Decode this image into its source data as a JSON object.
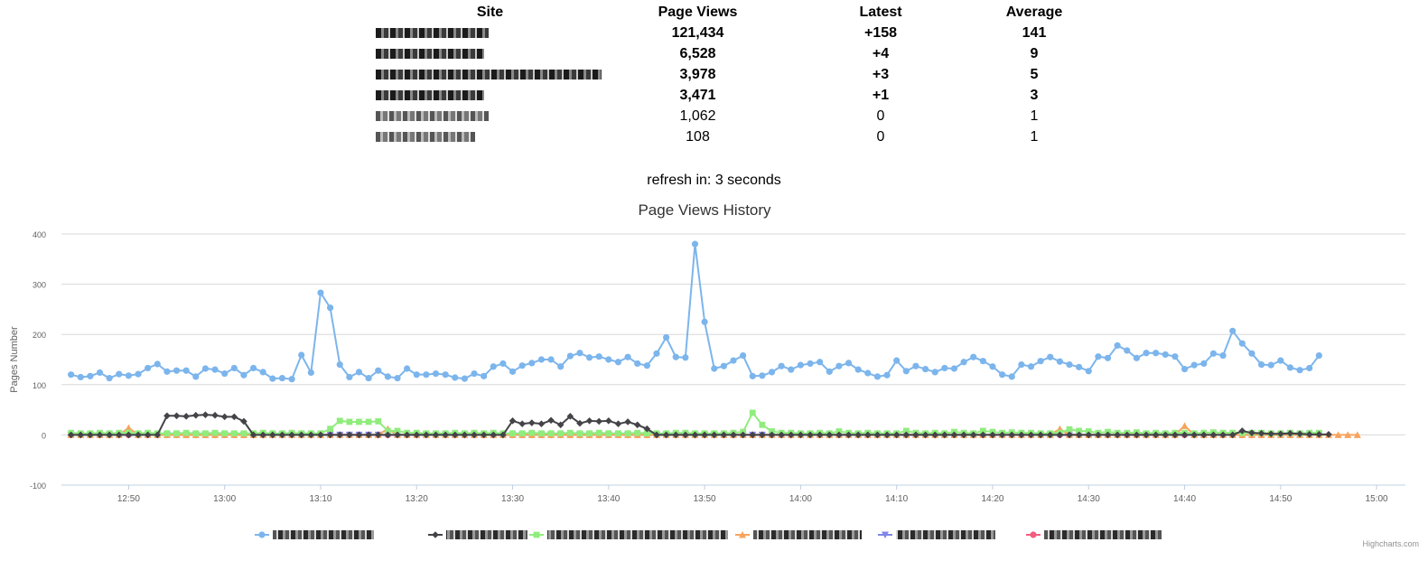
{
  "table": {
    "headers": {
      "site": "Site",
      "views": "Page Views",
      "latest": "Latest",
      "average": "Average"
    },
    "rows": [
      {
        "views": "121,434",
        "latest": "+158",
        "average": "141",
        "bold": true
      },
      {
        "views": "6,528",
        "latest": "+4",
        "average": "9",
        "bold": true
      },
      {
        "views": "3,978",
        "latest": "+3",
        "average": "5",
        "bold": true
      },
      {
        "views": "3,471",
        "latest": "+1",
        "average": "3",
        "bold": true
      },
      {
        "views": "1,062",
        "latest": "0",
        "average": "1",
        "bold": false
      },
      {
        "views": "108",
        "latest": "0",
        "average": "1",
        "bold": false
      }
    ]
  },
  "refresh": {
    "text": "refresh in: 3 seconds"
  },
  "credits": "Highcharts.com",
  "chart_data": {
    "type": "line",
    "title": "Page Views History",
    "ylabel": "Pages Number",
    "ylim": [
      -100,
      400
    ],
    "yticks": [
      -100,
      0,
      100,
      200,
      300,
      400
    ],
    "xlim": [
      "12:43",
      "15:03"
    ],
    "xticks": [
      "12:50",
      "13:00",
      "13:10",
      "13:20",
      "13:30",
      "13:40",
      "13:50",
      "14:00",
      "14:10",
      "14:20",
      "14:30",
      "14:40",
      "14:50",
      "15:00"
    ],
    "x_start": "12:44",
    "x_step_minutes": 1,
    "grid": true,
    "legend_position": "bottom",
    "series": [
      {
        "color": "#7cb5ec",
        "marker": "circle",
        "values": [
          120,
          115,
          117,
          124,
          113,
          121,
          118,
          121,
          133,
          141,
          126,
          128,
          128,
          116,
          132,
          130,
          122,
          133,
          119,
          133,
          125,
          112,
          113,
          111,
          159,
          124,
          283,
          253,
          140,
          115,
          125,
          113,
          128,
          116,
          113,
          132,
          120,
          120,
          122,
          120,
          114,
          112,
          122,
          117,
          136,
          142,
          126,
          138,
          143,
          150,
          150,
          136,
          157,
          163,
          154,
          156,
          150,
          145,
          155,
          142,
          138,
          162,
          194,
          155,
          154,
          380,
          225,
          132,
          137,
          148,
          158,
          117,
          118,
          125,
          137,
          130,
          139,
          142,
          145,
          126,
          137,
          143,
          130,
          123,
          116,
          119,
          148,
          127,
          137,
          131,
          125,
          133,
          132,
          145,
          155,
          147,
          136,
          120,
          116,
          140,
          136,
          147,
          155,
          146,
          140,
          135,
          127,
          156,
          153,
          178,
          168,
          153,
          163,
          163,
          160,
          156,
          131,
          139,
          142,
          162,
          158,
          207,
          182,
          162,
          140,
          139,
          148,
          134,
          129,
          133,
          158
        ]
      },
      {
        "color": "#434348",
        "marker": "diamond",
        "values": [
          0,
          0,
          0,
          0,
          0,
          0,
          0,
          0,
          0,
          0,
          38,
          38,
          37,
          39,
          40,
          39,
          36,
          36,
          27,
          0,
          0,
          0,
          0,
          0,
          0,
          0,
          0,
          0,
          0,
          0,
          0,
          0,
          0,
          0,
          0,
          0,
          0,
          0,
          0,
          0,
          0,
          0,
          0,
          0,
          0,
          0,
          28,
          22,
          24,
          22,
          29,
          20,
          37,
          23,
          28,
          27,
          28,
          22,
          26,
          20,
          12,
          0,
          0,
          0,
          0,
          0,
          0,
          0,
          0,
          0,
          0,
          0,
          0,
          0,
          0,
          0,
          0,
          0,
          0,
          0,
          0,
          0,
          0,
          0,
          0,
          0,
          0,
          0,
          0,
          0,
          0,
          0,
          0,
          0,
          0,
          0,
          0,
          0,
          0,
          0,
          0,
          0,
          0,
          0,
          0,
          0,
          0,
          0,
          0,
          0,
          0,
          0,
          0,
          0,
          0,
          0,
          0,
          0,
          0,
          0,
          0,
          0,
          8,
          4,
          3,
          2,
          2,
          3,
          2,
          1,
          1,
          1
        ]
      },
      {
        "color": "#90ed7d",
        "marker": "square",
        "values": [
          4,
          3,
          3,
          4,
          3,
          4,
          4,
          3,
          4,
          3,
          3,
          3,
          4,
          3,
          3,
          4,
          3,
          3,
          3,
          3,
          4,
          3,
          3,
          4,
          3,
          3,
          3,
          12,
          28,
          26,
          26,
          26,
          27,
          8,
          8,
          4,
          4,
          3,
          3,
          3,
          4,
          3,
          4,
          3,
          4,
          3,
          3,
          3,
          4,
          3,
          3,
          3,
          4,
          3,
          3,
          4,
          3,
          3,
          3,
          4,
          3,
          3,
          3,
          4,
          4,
          3,
          3,
          3,
          3,
          4,
          6,
          44,
          20,
          7,
          4,
          4,
          3,
          3,
          4,
          3,
          7,
          4,
          3,
          4,
          3,
          3,
          3,
          8,
          4,
          3,
          4,
          3,
          6,
          4,
          3,
          8,
          6,
          4,
          5,
          4,
          4,
          3,
          3,
          4,
          11,
          8,
          7,
          4,
          6,
          4,
          4,
          5,
          3,
          4,
          3,
          4,
          4,
          3,
          4,
          5,
          4,
          4,
          4,
          4,
          4,
          3,
          3,
          4,
          3,
          4,
          4
        ]
      },
      {
        "color": "#f7a35c",
        "marker": "triangle",
        "values": [
          0,
          0,
          0,
          0,
          0,
          0,
          14,
          0,
          0,
          0,
          0,
          0,
          0,
          0,
          0,
          0,
          0,
          0,
          0,
          0,
          0,
          0,
          0,
          0,
          0,
          0,
          0,
          0,
          0,
          0,
          0,
          0,
          0,
          12,
          0,
          0,
          0,
          0,
          0,
          0,
          0,
          0,
          0,
          0,
          0,
          0,
          0,
          0,
          0,
          0,
          0,
          0,
          0,
          0,
          0,
          0,
          0,
          0,
          0,
          0,
          0,
          0,
          0,
          0,
          0,
          0,
          0,
          0,
          0,
          0,
          0,
          0,
          0,
          0,
          0,
          0,
          0,
          0,
          0,
          0,
          0,
          0,
          0,
          0,
          0,
          0,
          0,
          0,
          0,
          0,
          0,
          0,
          0,
          0,
          0,
          0,
          0,
          0,
          0,
          0,
          0,
          0,
          0,
          12,
          0,
          0,
          0,
          0,
          0,
          0,
          0,
          0,
          0,
          0,
          0,
          0,
          18,
          0,
          0,
          0,
          0,
          0,
          0,
          0,
          0,
          0,
          0,
          0,
          0,
          0,
          0,
          0,
          0,
          0,
          0
        ]
      },
      {
        "color": "#8085e9",
        "marker": "triangle-down",
        "values": [
          0,
          0,
          0,
          0,
          0,
          0,
          0,
          0,
          0,
          0,
          0,
          0,
          0,
          0,
          0,
          0,
          0,
          0,
          0,
          0,
          0,
          0,
          0,
          0,
          0,
          0,
          0,
          0,
          0,
          0,
          0,
          0,
          0,
          0,
          0,
          0,
          0,
          0,
          0,
          0,
          0,
          0,
          0,
          0,
          0,
          0,
          0,
          0,
          0,
          0,
          0,
          0,
          0,
          0,
          0,
          0,
          0,
          0,
          0,
          0,
          0,
          0,
          0,
          0,
          0,
          0,
          0,
          0,
          0,
          0,
          0,
          0,
          0,
          0,
          0,
          0,
          0,
          0,
          0,
          0,
          0,
          0,
          0,
          0,
          0,
          0,
          0,
          0,
          0,
          0,
          0,
          0,
          0,
          0,
          0,
          0,
          0,
          0,
          0,
          0,
          0,
          0,
          0,
          0,
          0,
          0,
          0,
          0,
          0,
          0,
          0,
          0,
          0,
          0,
          0,
          0,
          0,
          0,
          0,
          0,
          0,
          0,
          0,
          0,
          0,
          0,
          0,
          0,
          0,
          0,
          0
        ]
      },
      {
        "color": "#f15c80",
        "marker": "circle",
        "values": [
          0,
          0,
          0,
          0,
          0,
          0,
          0,
          0,
          0,
          0,
          0,
          0,
          0,
          0,
          0,
          0,
          0,
          0,
          0,
          0,
          0,
          0,
          0,
          0,
          0,
          0,
          0,
          0,
          0,
          0,
          0,
          0,
          0,
          0,
          0,
          0,
          0,
          0,
          0,
          0,
          0,
          0,
          0,
          0,
          0,
          0,
          0,
          0,
          0,
          0,
          0,
          0,
          0,
          0,
          0,
          0,
          0,
          0,
          0,
          0,
          0,
          0,
          0,
          0,
          0,
          0,
          0,
          0,
          0,
          0,
          0,
          0,
          0,
          0,
          0,
          0,
          0,
          0,
          0,
          0,
          0,
          0,
          0,
          0,
          0,
          0,
          0,
          0,
          0,
          0,
          0,
          0,
          0,
          0,
          0,
          0,
          0,
          0,
          0,
          0,
          0,
          0,
          0,
          0,
          0,
          0,
          0,
          0,
          0,
          0,
          0,
          0,
          0,
          0,
          0,
          0,
          0,
          0,
          0,
          0,
          0,
          0,
          0,
          0,
          0,
          0,
          0,
          0,
          0,
          0,
          0
        ]
      }
    ]
  }
}
